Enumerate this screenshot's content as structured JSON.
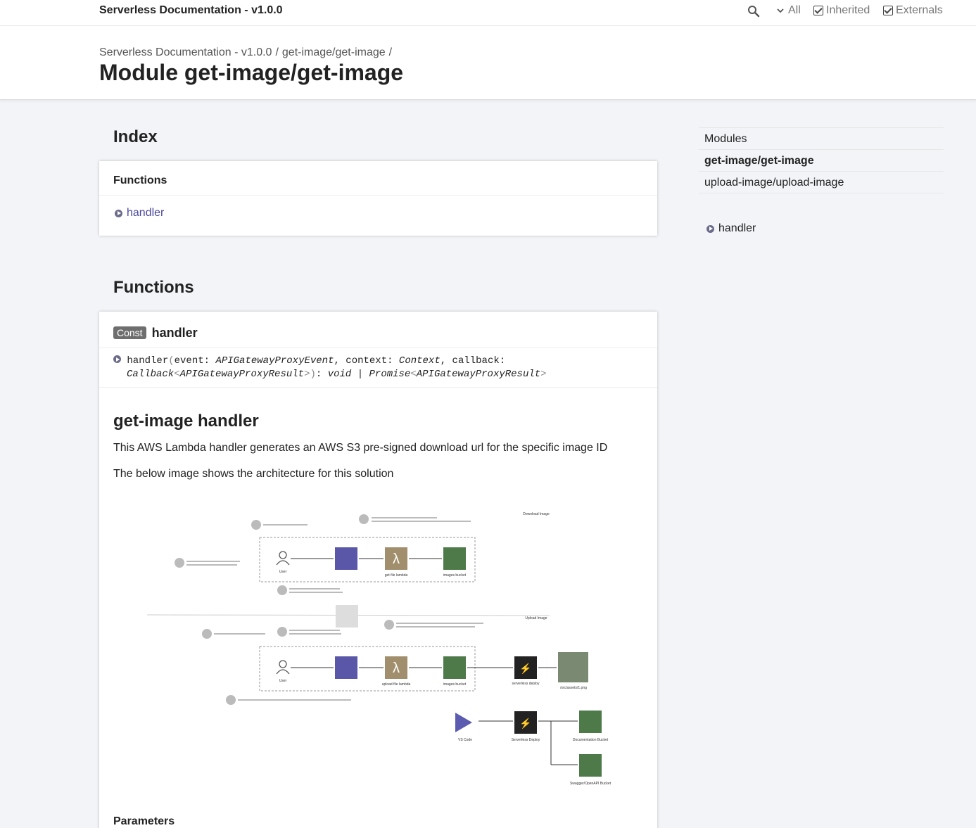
{
  "toolbar": {
    "title": "Serverless Documentation - v1.0.0",
    "filter_all": "All",
    "filter_inherited": "Inherited",
    "filter_externals": "Externals",
    "search_icon": "search-icon"
  },
  "header": {
    "breadcrumb": [
      "Serverless Documentation - v1.0.0",
      "/",
      "get-image/get-image",
      "/"
    ],
    "title": "Module get-image/get-image"
  },
  "index": {
    "title": "Index",
    "panel_title": "Functions",
    "items": [
      "handler"
    ]
  },
  "functions": {
    "title": "Functions",
    "badge": "Const",
    "name": "handler",
    "signature": {
      "fn": "handler",
      "p1": "event",
      "t1": "APIGatewayProxyEvent",
      "p2": "context",
      "t2": "Context",
      "p3": "callback",
      "t3a": "Callback",
      "t3b": "APIGatewayProxyResult",
      "ret1": "void",
      "ret2": "Promise",
      "ret3": "APIGatewayProxyResult"
    },
    "doc_heading": "get-image handler",
    "para1": "This AWS Lambda handler generates an AWS S3 pre-signed download url for the specific image ID",
    "para2": "The below image shows the architecture for this solution",
    "parameters_label": "Parameters"
  },
  "sidebar": {
    "items": [
      "Modules",
      "get-image/get-image",
      "upload-image/upload-image"
    ],
    "sub_items": [
      "handler"
    ]
  },
  "diagram_labels": {
    "download_title": "Download Image",
    "upload_title": "Upload Image",
    "user": "User",
    "get_lambda": "get file lambda",
    "upload_lambda": "upload file lambda",
    "images_bucket": "images bucket",
    "serverless_deploy": "serverless deploy",
    "serverless_deploy2": "Serverless Deploy",
    "assets": "/src/assets/1.png",
    "vscode": "VS Code",
    "doc_bucket": "Documentation Bucket",
    "swagger_bucket": "Swagger/OpenAPI Bucket"
  }
}
